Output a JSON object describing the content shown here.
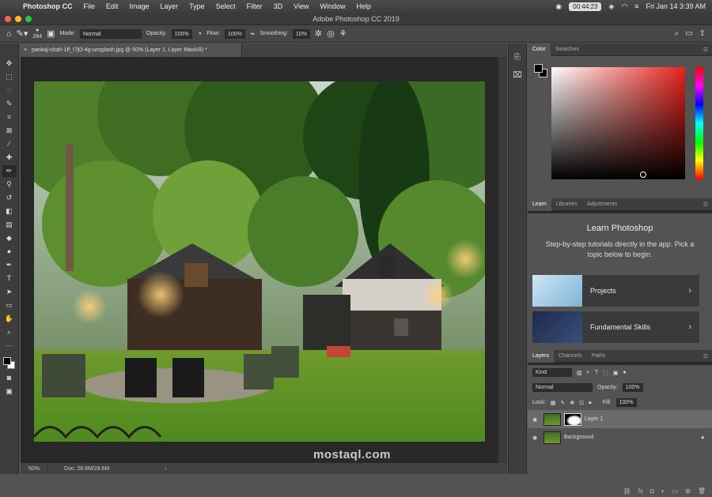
{
  "menubar": {
    "app": "Photoshop CC",
    "items": [
      "File",
      "Edit",
      "Image",
      "Layer",
      "Type",
      "Select",
      "Filter",
      "3D",
      "View",
      "Window",
      "Help"
    ],
    "timer": "00:44:23",
    "datetime": "Fri Jan 14  3:39 AM"
  },
  "window": {
    "title": "Adobe Photoshop CC 2019"
  },
  "options": {
    "brush_size": "284",
    "mode_label": "Mode:",
    "mode_value": "Normal",
    "opacity_label": "Opacity:",
    "opacity_value": "100%",
    "flow_label": "Flow:",
    "flow_value": "100%",
    "smoothing_label": "Smoothing:",
    "smoothing_value": "10%"
  },
  "document": {
    "tab_title": "pankaj-shah-1ff_i7jO-4g-unsplash.jpg @ 50% (Layer 1, Layer Mask/8) *",
    "zoom": "50%",
    "doc_size": "Doc: 28.6M/28.6M"
  },
  "color_panel": {
    "tabs": [
      "Color",
      "Swatches"
    ],
    "field_colors": {
      "hue": "#e8221b"
    }
  },
  "learn_panel": {
    "tabs": [
      "Learn",
      "Libraries",
      "Adjustments"
    ],
    "title": "Learn Photoshop",
    "description": "Step-by-step tutorials directly in the app. Pick a topic below to begin.",
    "cards": [
      {
        "label": "Projects"
      },
      {
        "label": "Fundamental Skills"
      }
    ]
  },
  "layers_panel": {
    "tabs": [
      "Layers",
      "Channels",
      "Paths"
    ],
    "filter_value": "Kind",
    "blend_mode": "Normal",
    "opacity_label": "Opacity:",
    "opacity_value": "100%",
    "lock_label": "Lock:",
    "fill_label": "Fill:",
    "fill_value": "100%",
    "layers": [
      {
        "name": "Layer 1",
        "selected": true
      },
      {
        "name": "Background",
        "selected": false
      }
    ],
    "bottom_icons": [
      "link-icon",
      "fx-icon",
      "mask-icon",
      "adjustment-icon",
      "folder-icon",
      "new-layer-icon",
      "trash-icon"
    ]
  },
  "watermark": "mostaql.com"
}
